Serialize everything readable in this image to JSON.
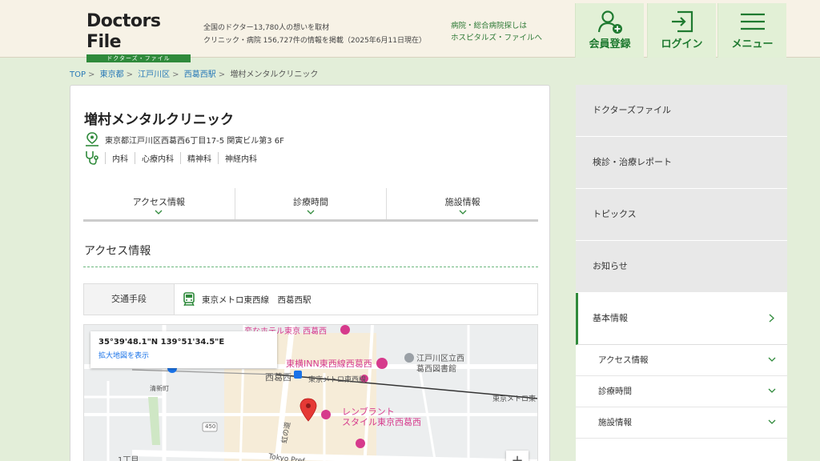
{
  "header": {
    "logo_main": "Doctors File",
    "logo_sub": "ドクターズ・ファイル",
    "tagline_line1": "全国のドクター13,780人の想いを取材",
    "tagline_line2": "クリニック・病院 156,727件の情報を掲載（2025年6月11日現在）",
    "hospital_link_line1": "病院・総合病院探しは",
    "hospital_link_line2": "ホスピタルズ・ファイルへ",
    "register_label": "会員登録",
    "login_label": "ログイン",
    "menu_label": "メニュー"
  },
  "breadcrumb": {
    "items": [
      "TOP",
      "東京都",
      "江戸川区",
      "西葛西駅"
    ],
    "current": "増村メンタルクリニック"
  },
  "clinic": {
    "name": "増村メンタルクリニック",
    "address": "東京都江戸川区西葛西6丁目17-5 関寅ビル第3 6F",
    "departments": [
      "内科",
      "心療内科",
      "精神科",
      "神経内科"
    ]
  },
  "tabs": [
    "アクセス情報",
    "診療時間",
    "施設情報"
  ],
  "access": {
    "section_title": "アクセス情報",
    "transport_label": "交通手段",
    "transport_value": "東京メトロ東西線　西葛西駅"
  },
  "map": {
    "coords": "35°39'48.1\"N 139°51'34.5\"E",
    "enlarge_link": "拡大地図を表示",
    "labels": {
      "hotel": "変なホテル東京 西葛西",
      "toyoko": "東横INN東西線西葛西",
      "library1": "江戸川区立西",
      "library2": "葛西図書館",
      "station": "西葛西",
      "line1": "東京メトロ東西線",
      "line2": "東京メトロ東",
      "rembrandt1": "レンブラント",
      "rembrandt2": "スタイル東京西葛西",
      "seishincho": "清新町",
      "route": "450",
      "street": "虹の道",
      "chome": "1丁目",
      "tokyo_pref": "Tokyo Pref"
    },
    "zoom_in": "+"
  },
  "sidebar": {
    "items": [
      "ドクターズファイル",
      "検診・治療レポート",
      "トピックス",
      "お知らせ"
    ],
    "active": "基本情報",
    "subitems": [
      "アクセス情報",
      "診療時間",
      "施設情報"
    ]
  }
}
